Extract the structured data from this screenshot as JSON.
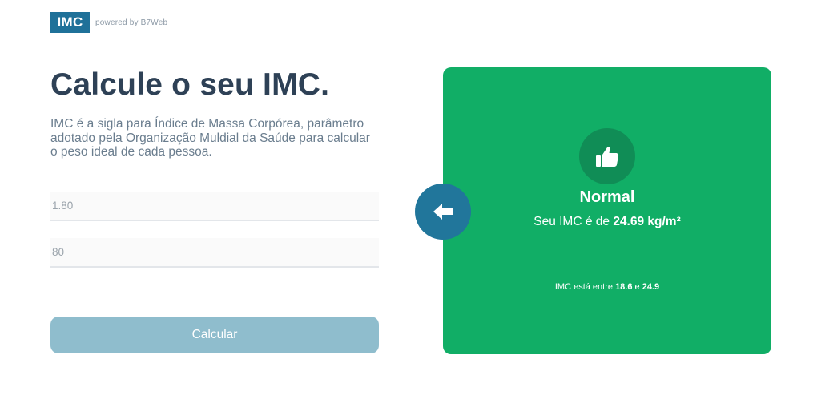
{
  "header": {
    "logo_text": "IMC",
    "powered_by": "powered by B7Web"
  },
  "main": {
    "title": "Calcule o seu IMC.",
    "description": "IMC é a sigla para Índice de Massa Corpórea, parâmetro adotado pela Organização Muldial da Saúde para calcular o peso ideal de cada pessoa.",
    "height_placeholder": "1.80",
    "weight_placeholder": "80",
    "calculate_label": "Calcular"
  },
  "result": {
    "icon": "thumbs-up-icon",
    "title": "Normal",
    "imc_prefix": "Seu IMC é de ",
    "imc_value": "24.69 kg/m²",
    "range_prefix": "IMC está entre ",
    "range_min": "18.6",
    "range_sep": " e ",
    "range_max": "24.9",
    "color": "#11ae66"
  },
  "back_button": {
    "icon": "arrow-left-icon"
  }
}
